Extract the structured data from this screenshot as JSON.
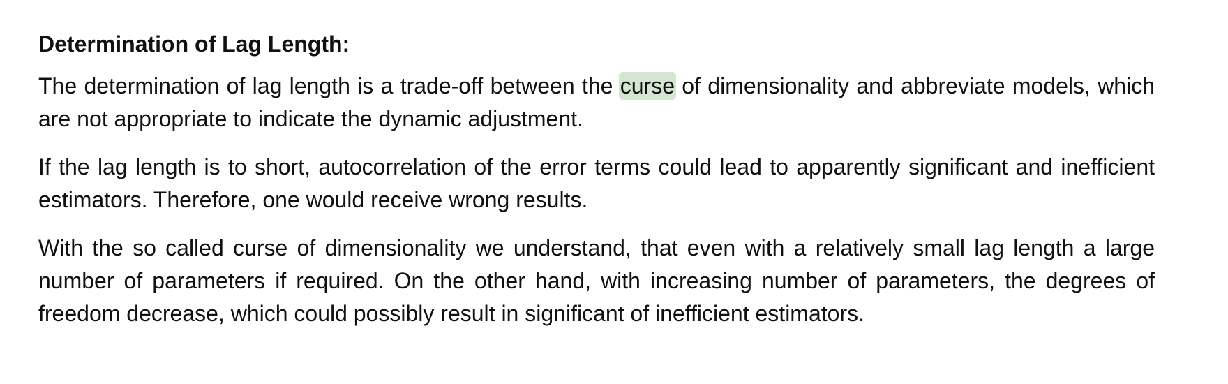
{
  "heading": "Determination of Lag Length:",
  "paragraph1": {
    "before_highlight": "The determination of lag length is a trade-off between the ",
    "highlight": "curse",
    "after_highlight": " of dimensionality and abbreviate models, which are not appropriate to indicate the dynamic adjustment."
  },
  "paragraph2": "If the lag length is to short, autocorrelation of the error terms could lead to apparently significant and inefficient estimators. Therefore, one would receive wrong results.",
  "paragraph3": "With the so called curse of dimensionality we understand, that even with a relatively small lag length a large number of parameters if required. On the other hand, with increasing number of parameters, the degrees of freedom decrease, which could possibly result in significant of inefficient estimators.",
  "colors": {
    "text": "#111111",
    "highlight": "#d3e6cf",
    "background": "#ffffff"
  }
}
